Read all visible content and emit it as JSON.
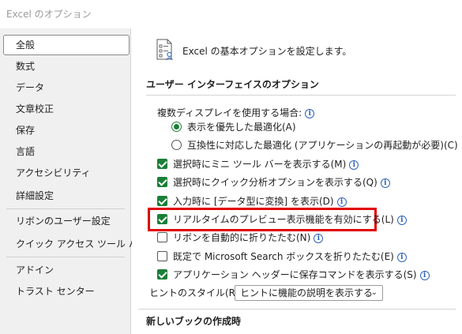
{
  "window": {
    "title": "Excel のオプション"
  },
  "sidebar": {
    "items": [
      {
        "label": "全般",
        "selected": true
      },
      {
        "label": "数式"
      },
      {
        "label": "データ"
      },
      {
        "label": "文章校正"
      },
      {
        "label": "保存"
      },
      {
        "label": "言語"
      },
      {
        "label": "アクセシビリティ"
      },
      {
        "label": "詳細設定"
      },
      {
        "label": "リボンのユーザー設定"
      },
      {
        "label": "クイック アクセス ツール バー"
      },
      {
        "label": "アドイン"
      },
      {
        "label": "トラスト センター"
      }
    ]
  },
  "main": {
    "header": "Excel の基本オプションを設定します。",
    "ui_section": {
      "title": "ユーザー インターフェイスのオプション",
      "multi_display_label": "複数ディスプレイを使用する場合:",
      "radio_optimize_display": "表示を優先した最適化(A)",
      "radio_optimize_compat": "互換性に対応した最適化 (アプリケーションの再起動が必要)(C)",
      "cb_mini_toolbar": "選択時にミニ ツール バーを表示する(M)",
      "cb_quick_analysis": "選択時にクイック分析オプションを表示する(Q)",
      "cb_data_type": "入力時に [データ型に変換] を表示(D)",
      "cb_live_preview": "リアルタイムのプレビュー表示機能を有効にする(L)",
      "cb_collapse_ribbon": "リボンを自動的に折りたたむ(N)",
      "cb_collapse_search": "既定で Microsoft Search ボックスを折りたたむ(E)",
      "cb_app_header": "アプリケーション ヘッダーに保存コマンドを表示する(S)",
      "tooltip_style_label": "ヒントのスタイル(R):",
      "tooltip_style_value": "ヒントに機能の説明を表示する"
    },
    "new_workbook_section": {
      "title": "新しいブックの作成時"
    }
  },
  "colors": {
    "checkbox": "#1a7f37",
    "highlight": "#e00000",
    "info": "#2e63b8"
  },
  "icons": [
    "options-document-icon",
    "info-icon",
    "chevron-down-icon"
  ]
}
